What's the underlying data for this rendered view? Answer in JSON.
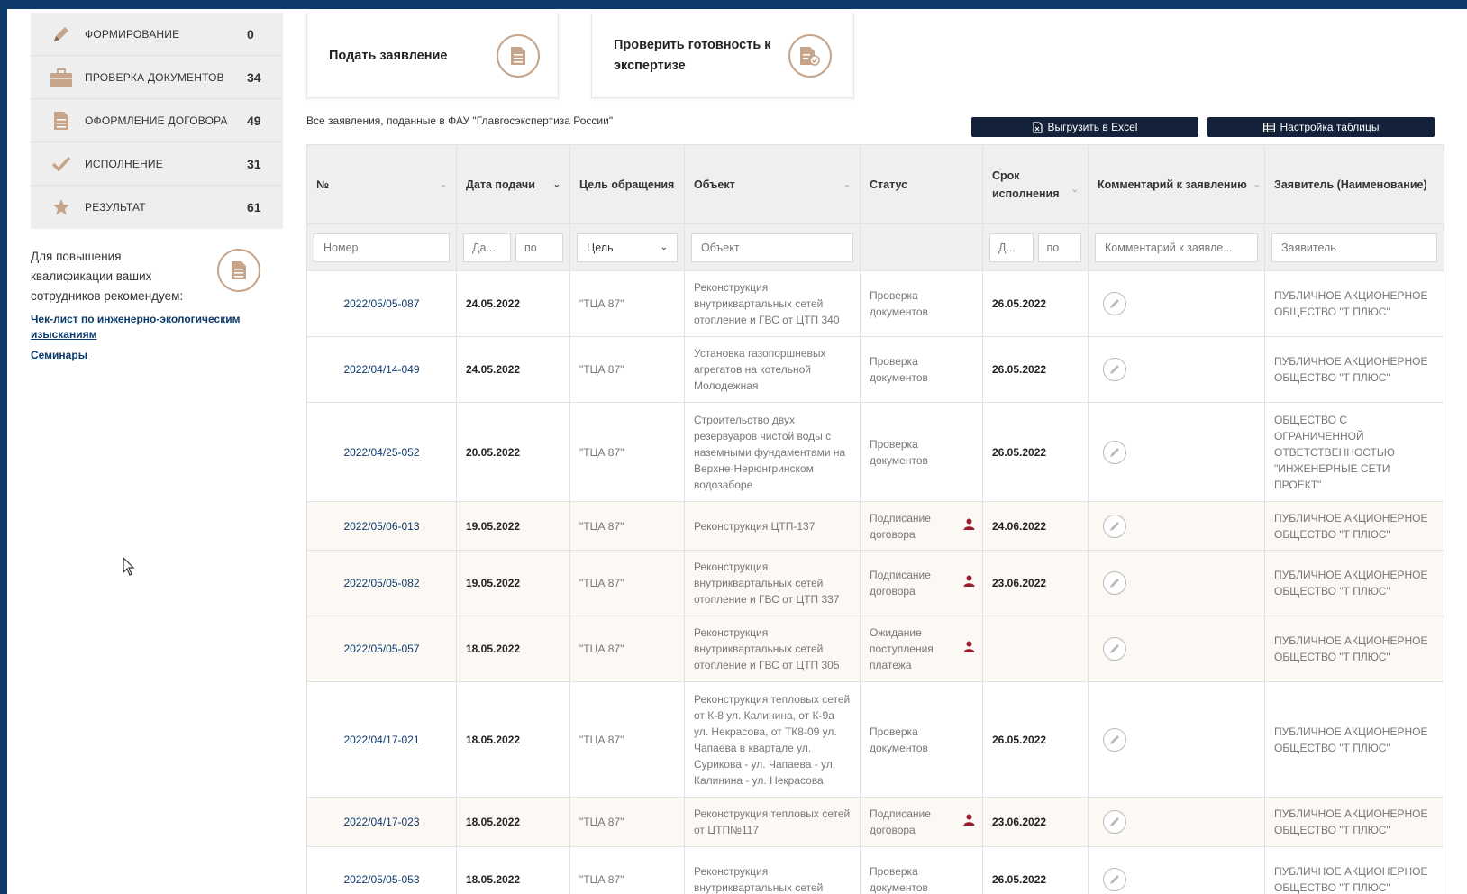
{
  "sidebar": {
    "stages": [
      {
        "label": "ФОРМИРОВАНИЕ",
        "count": "0",
        "icon": "pencil-icon"
      },
      {
        "label": "ПРОВЕРКА ДОКУМЕНТОВ",
        "count": "34",
        "icon": "briefcase-icon"
      },
      {
        "label": "ОФОРМЛЕНИЕ ДОГОВОРА",
        "count": "49",
        "icon": "document-icon"
      },
      {
        "label": "ИСПОЛНЕНИЕ",
        "count": "31",
        "icon": "checkmark-icon"
      },
      {
        "label": "РЕЗУЛЬТАТ",
        "count": "61",
        "icon": "star-icon"
      }
    ],
    "recommend_text": "Для повышения квалификации ваших сотрудников рекомендуем:",
    "links": [
      "Чек-лист по инженерно-экологическим изысканиям",
      "Семинары"
    ]
  },
  "actions": {
    "submit_label": "Подать заявление",
    "check_label": "Проверить готовность к экспертизе"
  },
  "subtitle": "Все заявления, поданные в ФАУ \"Главгосэкспертиза России\"",
  "toolbar": {
    "export_label": "Выгрузить в Excel",
    "settings_label": "Настройка таблицы"
  },
  "table": {
    "headers": {
      "num": "№",
      "date": "Дата подачи",
      "purpose": "Цель обращения",
      "object": "Объект",
      "status": "Статус",
      "deadline": "Срок исполнения",
      "comment": "Комментарий к заявлению",
      "applicant": "Заявитель (Наименование)"
    },
    "filters": {
      "num": "Номер",
      "date_from": "Да...",
      "date_to": "по",
      "purpose": "Цель",
      "object": "Объект",
      "deadline_from": "Д...",
      "deadline_to": "по",
      "comment": "Комментарий к заявле...",
      "applicant": "Заявитель"
    },
    "rows": [
      {
        "num": "2022/05/05-087",
        "date": "24.05.2022",
        "purpose": "\"ТЦА 87\"",
        "object": "Реконструкция внутриквартальных сетей отопление и ГВС от ЦТП 340",
        "status": "Проверка документов",
        "deadline": "26.05.2022",
        "applicant": "ПУБЛИЧНОЕ АКЦИОНЕРНОЕ ОБЩЕСТВО \"Т ПЛЮС\""
      },
      {
        "num": "2022/04/14-049",
        "date": "24.05.2022",
        "purpose": "\"ТЦА 87\"",
        "object": "Установка газопоршневых агрегатов на котельной Молодежная",
        "status": "Проверка документов",
        "deadline": "26.05.2022",
        "applicant": "ПУБЛИЧНОЕ АКЦИОНЕРНОЕ ОБЩЕСТВО \"Т ПЛЮС\""
      },
      {
        "num": "2022/04/25-052",
        "date": "20.05.2022",
        "purpose": "\"ТЦА 87\"",
        "object": "Строительство двух резервуаров чистой воды с наземными фундаментами на Верхне-Нерюнгринском водозаборе",
        "status": "Проверка документов",
        "deadline": "26.05.2022",
        "applicant": "ОБЩЕСТВО С ОГРАНИЧЕННОЙ ОТВЕТСТВЕННОСТЬЮ \"ИНЖЕНЕРНЫЕ СЕТИ ПРОЕКТ\""
      },
      {
        "num": "2022/05/06-013",
        "date": "19.05.2022",
        "purpose": "\"ТЦА 87\"",
        "object": "Реконструкция ЦТП-137",
        "status": "Подписание договора",
        "deadline": "24.06.2022",
        "applicant": "ПУБЛИЧНОЕ АКЦИОНЕРНОЕ ОБЩЕСТВО \"Т ПЛЮС\""
      },
      {
        "num": "2022/05/05-082",
        "date": "19.05.2022",
        "purpose": "\"ТЦА 87\"",
        "object": "Реконструкция внутриквартальных сетей отопление и ГВС от ЦТП 337",
        "status": "Подписание договора",
        "deadline": "23.06.2022",
        "applicant": "ПУБЛИЧНОЕ АКЦИОНЕРНОЕ ОБЩЕСТВО \"Т ПЛЮС\""
      },
      {
        "num": "2022/05/05-057",
        "date": "18.05.2022",
        "purpose": "\"ТЦА 87\"",
        "object": "Реконструкция внутриквартальных сетей отопление и ГВС от ЦТП 305",
        "status": "Ожидание поступления платежа",
        "deadline": "",
        "applicant": "ПУБЛИЧНОЕ АКЦИОНЕРНОЕ ОБЩЕСТВО \"Т ПЛЮС\""
      },
      {
        "num": "2022/04/17-021",
        "date": "18.05.2022",
        "purpose": "\"ТЦА 87\"",
        "object": "Реконструкция тепловых сетей от К-8 ул. Калинина, от К-9а ул. Некрасова, от ТК8-09 ул. Чапаева в квартале ул. Сурикова - ул. Чапаева - ул. Калинина - ул. Некрасова",
        "status": "Проверка документов",
        "deadline": "26.05.2022",
        "applicant": "ПУБЛИЧНОЕ АКЦИОНЕРНОЕ ОБЩЕСТВО \"Т ПЛЮС\""
      },
      {
        "num": "2022/04/17-023",
        "date": "18.05.2022",
        "purpose": "\"ТЦА 87\"",
        "object": "Реконструкция тепловых сетей от ЦТП№117",
        "status": "Подписание договора",
        "deadline": "23.06.2022",
        "applicant": "ПУБЛИЧНОЕ АКЦИОНЕРНОЕ ОБЩЕСТВО \"Т ПЛЮС\""
      },
      {
        "num": "2022/05/05-053",
        "date": "18.05.2022",
        "purpose": "\"ТЦА 87\"",
        "object": "Реконструкция внутриквартальных сетей",
        "status": "Проверка документов",
        "deadline": "26.05.2022",
        "applicant": "ПУБЛИЧНОЕ АКЦИОНЕРНОЕ ОБЩЕСТВО \"Т ПЛЮС\""
      }
    ]
  },
  "colors": {
    "accent": "#b48a6a",
    "dark": "#13213a",
    "frame": "#0d3a6b",
    "person": "#9b1c2e"
  }
}
